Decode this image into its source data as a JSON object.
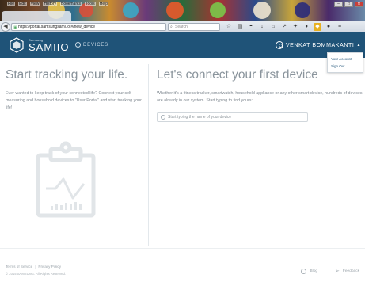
{
  "browser": {
    "menu": [
      "File",
      "Edit",
      "View",
      "History",
      "Bookmarks",
      "Tools",
      "Help"
    ],
    "url": "https://portal.samsungsami.io/#/new_device",
    "search_placeholder": "Search",
    "window_buttons": [
      "–",
      "□",
      "✕"
    ]
  },
  "header": {
    "logo_small": "Samsung",
    "logo_text": "SAMIIO",
    "nav_devices": "DEVICES",
    "user_name": "VENKAT BOMMAKANTI",
    "caret": "▲"
  },
  "user_dropdown": {
    "items": [
      "Your Account",
      "Sign Out"
    ]
  },
  "left": {
    "title": "Start tracking your life.",
    "description": "Ever wanted to keep track of your connected life? Connect your self - measuring and household devices to \"User Portal\" and start tracking your life!"
  },
  "right": {
    "title": "Let's connect your first device",
    "description": "Whether it's a fitness tracker, smartwatch, household appliance or any other smart device, hundreds of devices are already in our system. Start typing to find yours:",
    "search_placeholder": "Start typing the name of your device"
  },
  "footer": {
    "terms": "Terms of Service",
    "separator": "|",
    "privacy": "Privacy Policy",
    "copyright": "© 2015 SAMSUNG. All Rights Reserved.",
    "blog": "Blog",
    "feedback": "Feedback"
  },
  "colors": {
    "header_bg": "#1f5378",
    "title_gray": "#8a949c",
    "illustration": "#e3e6e9"
  }
}
